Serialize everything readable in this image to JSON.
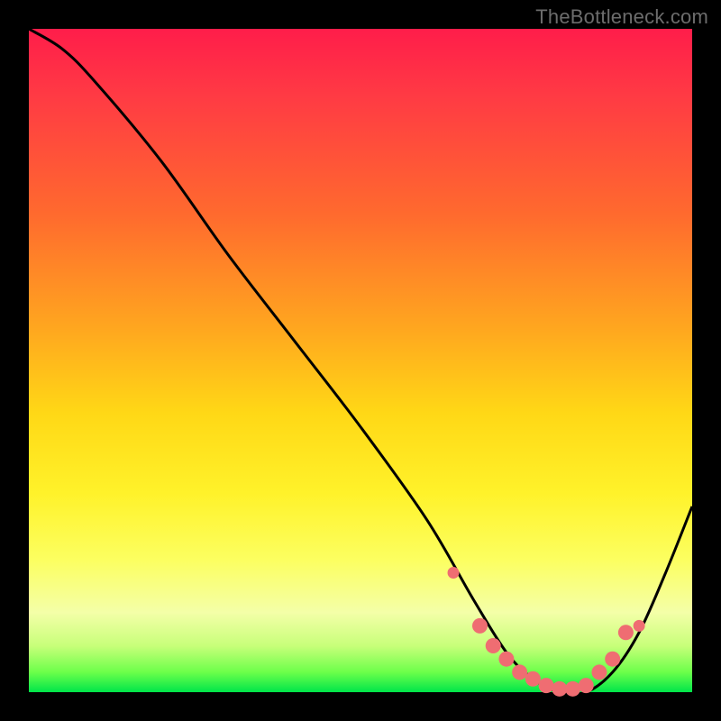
{
  "watermark": "TheBottleneck.com",
  "chart_data": {
    "type": "line",
    "title": "",
    "xlabel": "",
    "ylabel": "",
    "xlim": [
      0,
      100
    ],
    "ylim": [
      0,
      100
    ],
    "grid": false,
    "series": [
      {
        "name": "curve",
        "x": [
          0,
          5,
          10,
          20,
          30,
          40,
          50,
          60,
          67,
          72,
          76,
          80,
          84,
          88,
          92,
          96,
          100
        ],
        "y": [
          100,
          97,
          92,
          80,
          66,
          53,
          40,
          26,
          14,
          6,
          2,
          0,
          0,
          3,
          9,
          18,
          28
        ]
      }
    ],
    "markers": {
      "name": "highlight-points",
      "color": "#ef6d72",
      "x": [
        64,
        68,
        70,
        72,
        74,
        76,
        78,
        80,
        82,
        84,
        86,
        88,
        90,
        92
      ],
      "y": [
        18,
        10,
        7,
        5,
        3,
        2,
        1,
        0.5,
        0.5,
        1,
        3,
        5,
        9,
        10
      ]
    },
    "background_gradient": {
      "top": "#ff1d4a",
      "mid": "#ffd816",
      "bottom": "#00e54a"
    }
  }
}
